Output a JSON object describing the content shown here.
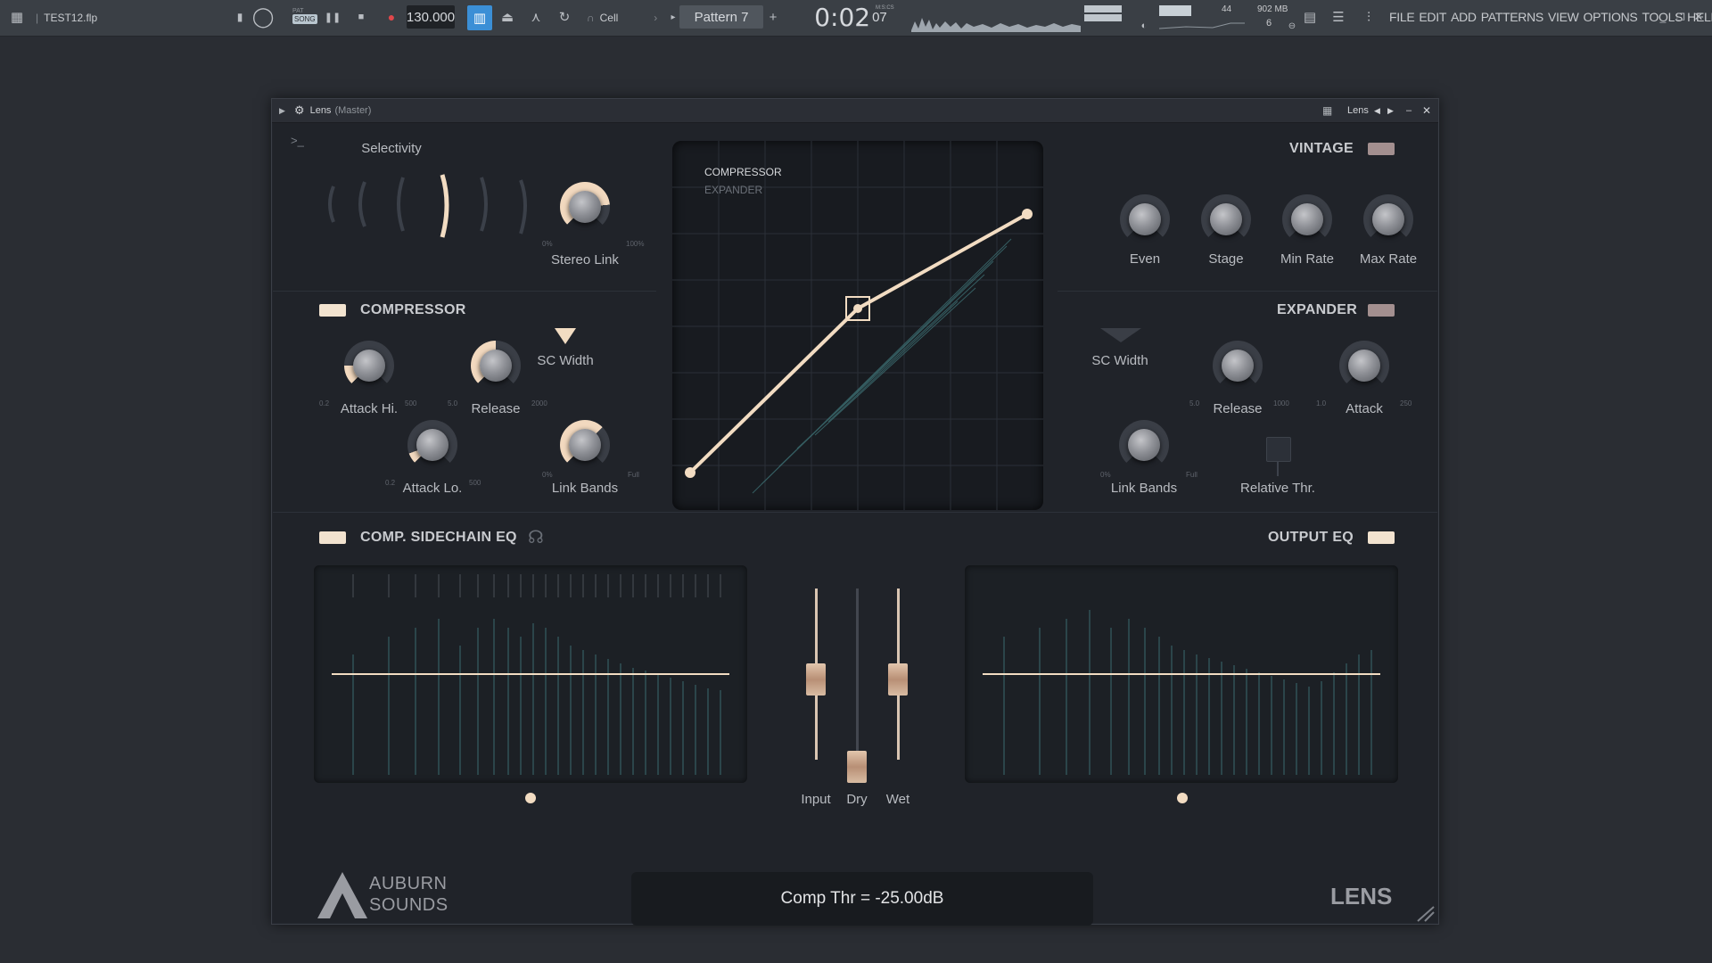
{
  "toolbar": {
    "file_name": "TEST12.flp",
    "song_label": "SONG",
    "pat_label": "PAT",
    "tempo": "130.000",
    "snap": "Cell",
    "pattern": "Pattern 7",
    "time_main": "0:02",
    "time_sub": "07",
    "time_unit": "M:S:CS",
    "cpu_value": "44",
    "memory": "902 MB",
    "voices": "6",
    "menu": [
      "FILE",
      "EDIT",
      "ADD",
      "PATTERNS",
      "VIEW",
      "OPTIONS",
      "TOOLS",
      "HELP"
    ]
  },
  "window": {
    "title": "Lens",
    "subtitle": "(Master)",
    "preset_name": "Lens"
  },
  "selectivity": {
    "label": "Selectivity",
    "stereo_link": {
      "label": "Stereo Link",
      "min": "0%",
      "max": "100%"
    }
  },
  "graph": {
    "mode_active": "COMPRESSOR",
    "mode_inactive": "EXPANDER"
  },
  "vintage": {
    "label": "VINTAGE",
    "knobs": [
      "Even",
      "Stage",
      "Min Rate",
      "Max Rate"
    ]
  },
  "compressor": {
    "label": "COMPRESSOR",
    "attack_hi": {
      "label": "Attack Hi.",
      "min": "0.2",
      "max": "500"
    },
    "release": {
      "label": "Release",
      "min": "5.0",
      "max": "2000"
    },
    "sc_width": {
      "label": "SC Width"
    },
    "attack_lo": {
      "label": "Attack Lo.",
      "min": "0.2",
      "max": "500"
    },
    "link_bands": {
      "label": "Link Bands",
      "min": "0%",
      "max": "Full"
    }
  },
  "expander": {
    "label": "EXPANDER",
    "sc_width": {
      "label": "SC Width"
    },
    "release": {
      "label": "Release",
      "min": "5.0",
      "max": "1000"
    },
    "attack": {
      "label": "Attack",
      "min": "1.0",
      "max": "250"
    },
    "link_bands": {
      "label": "Link Bands",
      "min": "0%",
      "max": "Full"
    },
    "relative_thr": {
      "label": "Relative Thr."
    }
  },
  "sidechain_eq": {
    "label": "COMP. SIDECHAIN EQ"
  },
  "output_eq": {
    "label": "OUTPUT EQ"
  },
  "mix": {
    "faders": [
      {
        "label": "Input"
      },
      {
        "label": "Dry"
      },
      {
        "label": "Wet"
      }
    ]
  },
  "brand": {
    "line1": "AUBURN",
    "line2": "SOUNDS",
    "product": "LENS"
  },
  "status_text": "Comp Thr = -25.00dB",
  "colors": {
    "accent": "#f2dcc2",
    "toggle_on": "#f2e3cf",
    "toggle_off": "#a38f8f",
    "background": "#202329"
  }
}
